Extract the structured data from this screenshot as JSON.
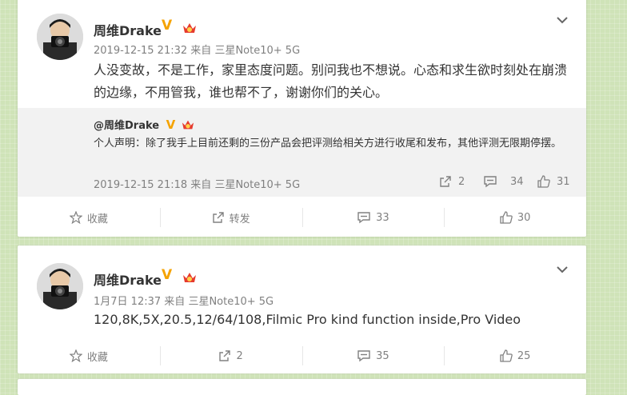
{
  "posts": [
    {
      "user": {
        "name": "周维Drake",
        "verified_mark": "V"
      },
      "meta": {
        "date": "2019-12-15 21:32",
        "source_prefix": "来自",
        "source": "三星Note10+ 5G"
      },
      "text": "人没变故，不是工作，家里态度问题。别问我也不想说。心态和求生欲时刻处在崩溃的边缘，不用管我，谁也帮不了，谢谢你们的关心。",
      "retweet": {
        "author": "@周维Drake",
        "verified_mark": "V",
        "text": "个人声明：除了我手上目前还剩的三份产品会把评测给相关方进行收尾和发布，其他评测无限期停摆。",
        "meta": {
          "date": "2019-12-15 21:18",
          "source_prefix": "来自",
          "source": "三星Note10+ 5G"
        },
        "stats": {
          "reposts": "2",
          "comments": "34",
          "likes": "31"
        }
      },
      "actions": {
        "favorite": "收藏",
        "repost": "转发",
        "comment": "33",
        "like": "30"
      }
    },
    {
      "user": {
        "name": "周维Drake",
        "verified_mark": "V"
      },
      "meta": {
        "date": "1月7日 12:37",
        "source_prefix": "来自",
        "source": "三星Note10+ 5G"
      },
      "text": "120,8K,5X,20.5,12/64/108,Filmic Pro kind function inside,Pro Video",
      "actions": {
        "favorite": "收藏",
        "repost": "2",
        "comment": "35",
        "like": "25"
      }
    }
  ],
  "icons": {
    "chevron": "chevron-down-icon",
    "star": "star-icon",
    "repost": "repost-icon",
    "comment": "comment-icon",
    "like": "thumbs-up-icon",
    "vip": "vip-crown-icon"
  },
  "colors": {
    "page_background": "#cfe3b8",
    "verified": "#f5a300",
    "vip": "#e63b2e",
    "meta_text": "#808080",
    "retweet_background": "#f2f2f2"
  }
}
